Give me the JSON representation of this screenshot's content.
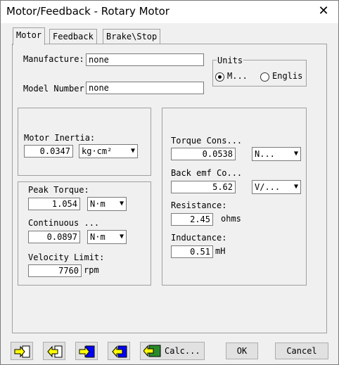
{
  "window": {
    "title": "Motor/Feedback - Rotary Motor",
    "close_glyph": "✕"
  },
  "tabs": [
    {
      "label": "Motor"
    },
    {
      "label": "Feedback"
    },
    {
      "label": "Brake\\Stop"
    }
  ],
  "motor": {
    "manufacturer": {
      "label": "Manufacture:",
      "value": "none"
    },
    "model_number": {
      "label": "Model Number:",
      "value": "none"
    },
    "units": {
      "title": "Units",
      "options": [
        {
          "label": "M...",
          "selected": true
        },
        {
          "label": "Englis",
          "selected": false
        }
      ]
    },
    "inertia": {
      "label": "Motor Inertia:",
      "value": "0.0347",
      "unit": "kg·cm²"
    },
    "peak_torque": {
      "label": "Peak Torque:",
      "value": "1.054",
      "unit": "N·m"
    },
    "continuous": {
      "label": "Continuous ...",
      "value": "0.0897",
      "unit": "N·m"
    },
    "velocity_limit": {
      "label": "Velocity Limit:",
      "value": "7760",
      "unit": "rpm"
    },
    "torque_constant": {
      "label": "Torque Cons...",
      "value": "0.0538",
      "unit": "N..."
    },
    "back_emf": {
      "label": "Back emf Co...",
      "value": "5.62",
      "unit": "V/..."
    },
    "resistance": {
      "label": "Resistance:",
      "value": "2.45",
      "unit": "ohms"
    },
    "inductance": {
      "label": "Inductance:",
      "value": "0.51",
      "unit": "mH"
    }
  },
  "footer": {
    "calc_label": "Calc...",
    "ok_label": "OK",
    "cancel_label": "Cancel"
  },
  "colors": {
    "icon_yellow": "#ffff00",
    "icon_blue": "#0000ff",
    "icon_green": "#2a8a2a"
  }
}
